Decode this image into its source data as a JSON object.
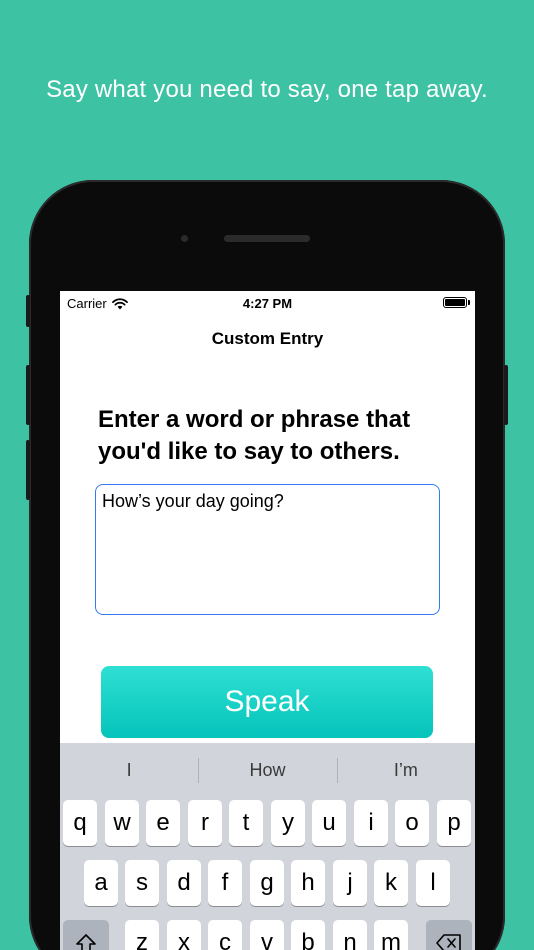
{
  "tagline": "Say what you need to say, one tap away.",
  "status_bar": {
    "carrier": "Carrier",
    "time": "4:27 PM"
  },
  "nav": {
    "title": "Custom Entry"
  },
  "prompt": "Enter a word or phrase that you'd like to say to others.",
  "entry": {
    "value": "How’s your day going?"
  },
  "speak_label": "Speak",
  "suggestions": [
    "I",
    "How",
    "I’m"
  ],
  "keyboard": {
    "row1": [
      "q",
      "w",
      "e",
      "r",
      "t",
      "y",
      "u",
      "i",
      "o",
      "p"
    ],
    "row2": [
      "a",
      "s",
      "d",
      "f",
      "g",
      "h",
      "j",
      "k",
      "l"
    ],
    "row3": [
      "z",
      "x",
      "c",
      "v",
      "b",
      "n",
      "m"
    ]
  },
  "colors": {
    "background": "#3ec2a4",
    "accent": "#05c4bb",
    "field_border": "#3478f6"
  }
}
